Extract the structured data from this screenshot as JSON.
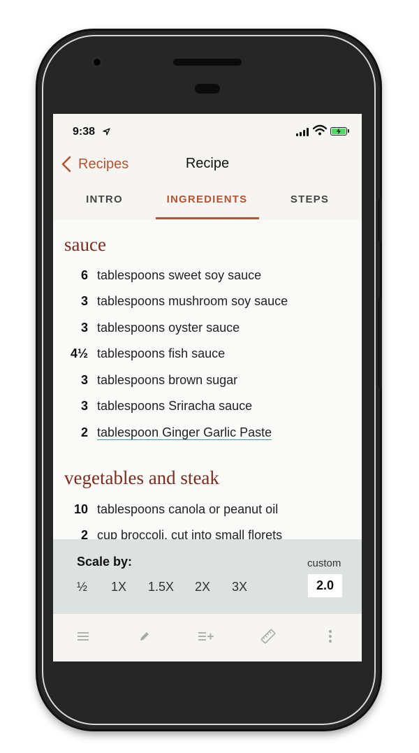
{
  "status": {
    "time": "9:38",
    "location_icon": "location-arrow-icon",
    "battery_color": "#4cd964"
  },
  "nav": {
    "back_label": "Recipes",
    "title": "Recipe"
  },
  "tabs": [
    {
      "label": "INTRO",
      "active": false
    },
    {
      "label": "INGREDIENTS",
      "active": true
    },
    {
      "label": "STEPS",
      "active": false
    }
  ],
  "sections": [
    {
      "title": "sauce",
      "items": [
        {
          "qty": "6",
          "text": "tablespoons sweet soy sauce"
        },
        {
          "qty": "3",
          "text": "tablespoons mushroom soy sauce"
        },
        {
          "qty": "3",
          "text": "tablespoons oyster sauce"
        },
        {
          "qty": "4½",
          "text": "tablespoons fish sauce"
        },
        {
          "qty": "3",
          "text": "tablespoons brown sugar"
        },
        {
          "qty": "3",
          "text": "tablespoons Sriracha sauce"
        },
        {
          "qty": "2",
          "text": "tablespoon Ginger Garlic Paste",
          "link": true
        }
      ]
    },
    {
      "title": "vegetables and steak",
      "items": [
        {
          "qty": "10",
          "text": "tablespoons canola or peanut oil"
        },
        {
          "qty": "2",
          "text": "cup broccoli, cut into small florets"
        }
      ]
    }
  ],
  "scale": {
    "label": "Scale by:",
    "options": [
      "½",
      "1X",
      "1.5X",
      "2X",
      "3X"
    ],
    "custom_label": "custom",
    "custom_value": "2.0"
  },
  "toolbar": {
    "icons": [
      "list-icon",
      "pencil-icon",
      "add-to-list-icon",
      "ruler-icon",
      "more-vertical-icon"
    ]
  },
  "colors": {
    "accent": "#b3532f",
    "section_title": "#7a2e1e",
    "link_underline": "#4a9aa8"
  }
}
